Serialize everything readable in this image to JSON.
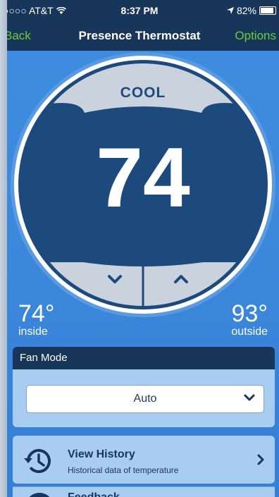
{
  "status_bar": {
    "carrier": "●○○○ AT&T",
    "time": "8:37 PM",
    "battery": "82%"
  },
  "nav": {
    "back_label": "Back",
    "title": "Presence Thermostat",
    "options_label": "Options"
  },
  "thermostat": {
    "mode": "COOL",
    "setpoint": "74",
    "inside_temp": "74°",
    "inside_label": "inside",
    "outside_temp": "93°",
    "outside_label": "outside"
  },
  "fan": {
    "header": "Fan Mode",
    "selected": "Auto"
  },
  "history": {
    "title": "View History",
    "subtitle": "Historical data of temperature"
  },
  "next_item": {
    "title": "Feedback"
  },
  "colors": {
    "navbar": "#17365a",
    "accent": "#6ccd3a",
    "background": "#3a86db",
    "card": "#a9cdf1",
    "dial_dark": "#1d4a7d",
    "dial_ring": "#c9d2dd"
  }
}
